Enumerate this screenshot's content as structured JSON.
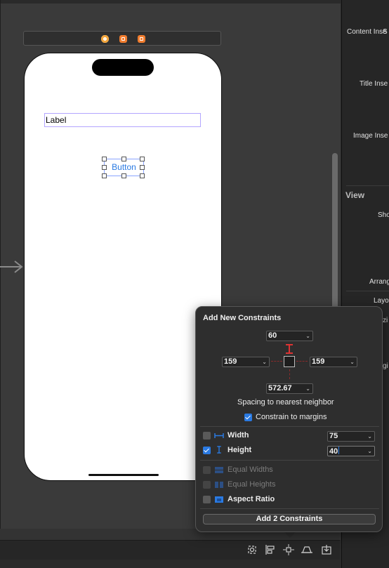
{
  "canvas": {
    "label_text": "Label",
    "button_text": "Button"
  },
  "inspector": {
    "rows": [
      "S",
      "Content Inse",
      "Title Inse",
      "Image Inse",
      "Sho",
      "Arrang",
      "Layo",
      "zi",
      "gi"
    ],
    "section_view": "View"
  },
  "constraints_popover": {
    "title": "Add New Constraints",
    "top_value": "60",
    "left_value": "159",
    "right_value": "159",
    "bottom_value": "572.67",
    "spacing_caption": "Spacing to nearest neighbor",
    "constrain_to_margins": {
      "label": "Constrain to margins",
      "checked": true
    },
    "width": {
      "label": "Width",
      "value": "75",
      "checked": false
    },
    "height": {
      "label": "Height",
      "value": "40",
      "checked": true
    },
    "equal_widths": {
      "label": "Equal Widths",
      "checked": false,
      "enabled": false
    },
    "equal_heights": {
      "label": "Equal Heights",
      "checked": false,
      "enabled": false
    },
    "aspect_ratio": {
      "label": "Aspect Ratio",
      "checked": false,
      "enabled": true
    },
    "add_button": "Add 2 Constraints"
  },
  "toolbar": {
    "icons": [
      "update-frames-icon",
      "align-icon",
      "add-constraints-icon",
      "resolve-issues-icon",
      "embed-in-icon"
    ]
  },
  "colors": {
    "accent": "#2a7ae2",
    "strut_red": "#dd3333",
    "dock_orange": "#f07c2e"
  }
}
